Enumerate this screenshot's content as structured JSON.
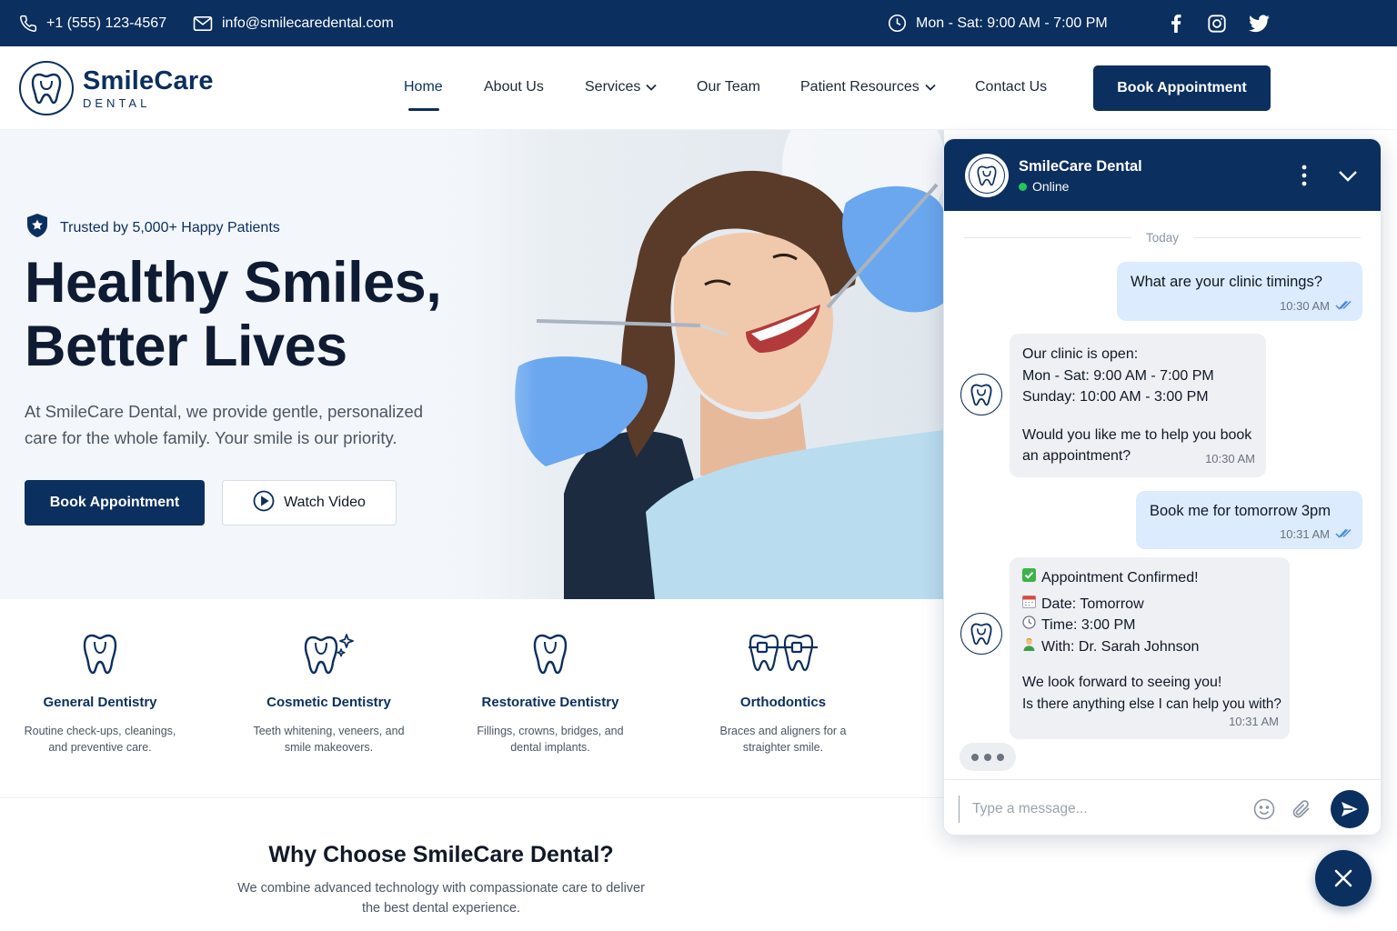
{
  "topbar": {
    "phone": "+1 (555) 123-4567",
    "email": "info@smilecaredental.com",
    "hours": "Mon - Sat: 9:00 AM - 7:00 PM",
    "social": [
      "facebook-icon",
      "instagram-icon",
      "twitter-icon"
    ]
  },
  "brand": {
    "name": "SmileCare",
    "sub": "DENTAL",
    "color": "#0b2f5e"
  },
  "nav": {
    "items": [
      {
        "label": "Home",
        "active": true
      },
      {
        "label": "About Us"
      },
      {
        "label": "Services",
        "dropdown": true
      },
      {
        "label": "Our Team"
      },
      {
        "label": "Patient Resources",
        "dropdown": true
      },
      {
        "label": "Contact Us"
      }
    ],
    "cta": "Book Appointment"
  },
  "hero": {
    "trust": "Trusted by 5,000+ Happy Patients",
    "headline_1": "Healthy Smiles,",
    "headline_2": "Better Lives",
    "subtext": "At SmileCare Dental, we provide gentle, personalized care for the whole family. Your smile is our priority.",
    "primary_btn": "Book Appointment",
    "secondary_btn": "Watch Video"
  },
  "services": [
    {
      "title": "General Dentistry",
      "desc_1": "Routine check-ups, cleanings,",
      "desc_2": "and preventive care.",
      "icon": "tooth-icon"
    },
    {
      "title": "Cosmetic Dentistry",
      "desc_1": "Teeth whitening, veneers, and",
      "desc_2": "smile makeovers.",
      "icon": "sparkle-tooth-icon"
    },
    {
      "title": "Restorative Dentistry",
      "desc_1": "Fillings, crowns, bridges, and",
      "desc_2": "dental implants.",
      "icon": "tooth-icon"
    },
    {
      "title": "Orthodontics",
      "desc_1": "Braces and aligners for a",
      "desc_2": "straighter smile.",
      "icon": "braces-icon"
    }
  ],
  "why": {
    "title": "Why Choose SmileCare Dental?",
    "text_1": "We combine advanced technology with compassionate care to deliver",
    "text_2": "the best dental experience."
  },
  "chat": {
    "name": "SmileCare Dental",
    "status": "Online",
    "day_label": "Today",
    "messages": [
      {
        "from": "user",
        "text": "What are your clinic timings?",
        "time": "10:30 AM"
      },
      {
        "from": "bot",
        "lines": [
          "Our clinic is open:",
          "Mon - Sat: 9:00 AM - 7:00 PM",
          "Sunday: 10:00 AM - 3:00 PM",
          "",
          "Would you like me to help you book",
          "an appointment?"
        ],
        "time": "10:30 AM"
      },
      {
        "from": "user",
        "text": "Book me for tomorrow 3pm",
        "time": "10:31 AM"
      },
      {
        "from": "bot",
        "lines": [
          "Appointment Confirmed!",
          "Date: Tomorrow",
          "Time: 3:00 PM",
          "With: Dr. Sarah Johnson",
          "",
          "We look forward to seeing you!",
          "Is there anything else I can help you with?"
        ],
        "time": "10:31 AM"
      }
    ],
    "input_placeholder": "Type a message..."
  }
}
